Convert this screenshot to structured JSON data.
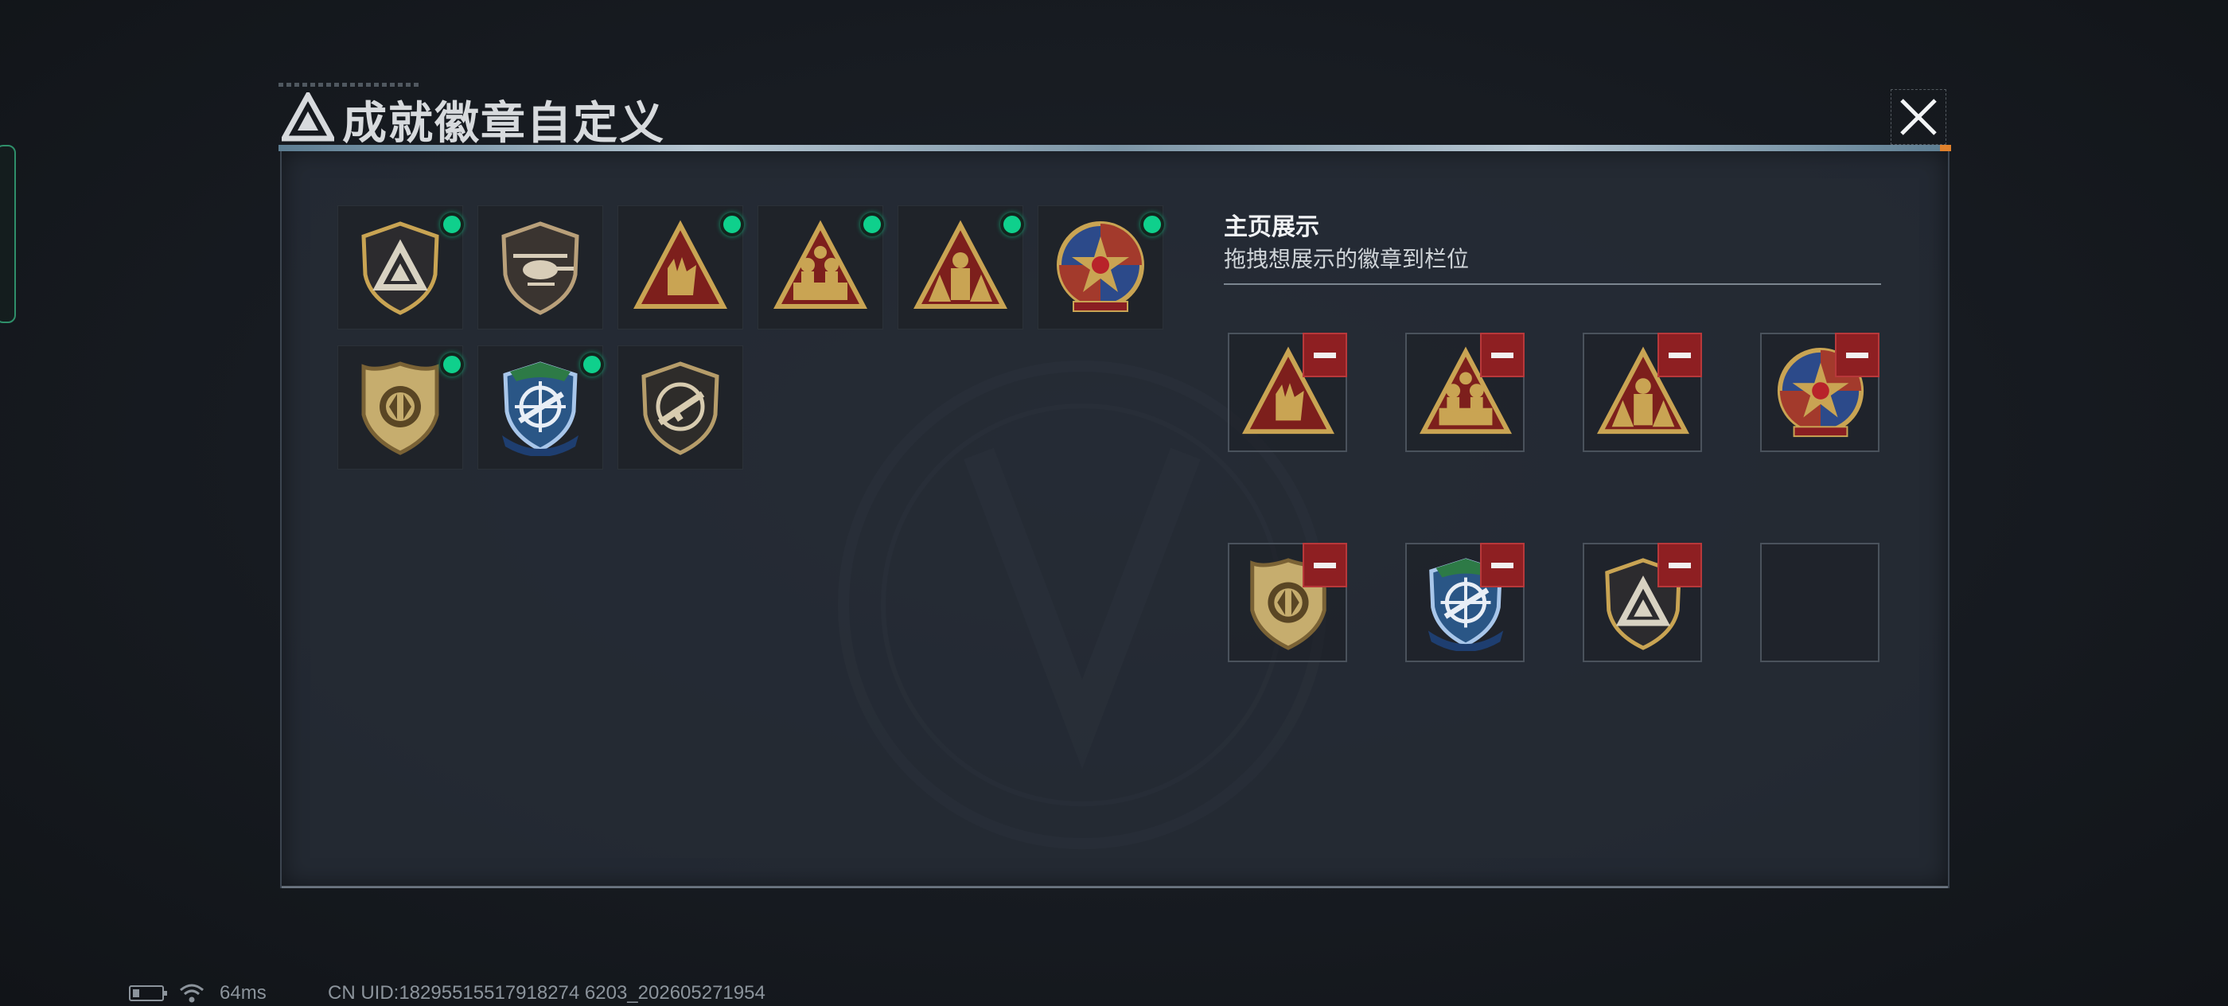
{
  "title": "成就徽章自定义",
  "section": {
    "title": "主页展示",
    "subtitle": "拖拽想展示的徽章到栏位"
  },
  "owned_badges": [
    {
      "icon": "triangle-shield-badge",
      "equipped": true
    },
    {
      "icon": "helicopter-shield-badge",
      "equipped": false
    },
    {
      "icon": "hand-triangle-badge",
      "equipped": true
    },
    {
      "icon": "soldiers-triangle-badge",
      "equipped": true
    },
    {
      "icon": "squad-triangle-badge",
      "equipped": true
    },
    {
      "icon": "star-skull-medal-badge",
      "equipped": true
    },
    {
      "icon": "emblem-shield-badge",
      "equipped": true
    },
    {
      "icon": "crosshair-rifle-blue-badge",
      "equipped": true
    },
    {
      "icon": "rifle-shield-badge",
      "equipped": false
    }
  ],
  "display_slots": [
    {
      "icon": "hand-triangle-badge",
      "filled": true
    },
    {
      "icon": "soldiers-triangle-badge",
      "filled": true
    },
    {
      "icon": "squad-triangle-badge",
      "filled": true
    },
    {
      "icon": "star-skull-medal-badge",
      "filled": true
    },
    {
      "icon": "emblem-shield-badge",
      "filled": true
    },
    {
      "icon": "crosshair-rifle-blue-badge",
      "filled": true
    },
    {
      "icon": "triangle-shield-badge",
      "filled": true
    },
    {
      "icon": "",
      "filled": false
    }
  ],
  "status": {
    "ping": "64ms",
    "uid": "CN UID:18295515517918274 6203_202605271954"
  },
  "colors": {
    "accent_green": "#0fd08c",
    "remove_red": "#8e1f22",
    "gold": "#c9a453"
  }
}
